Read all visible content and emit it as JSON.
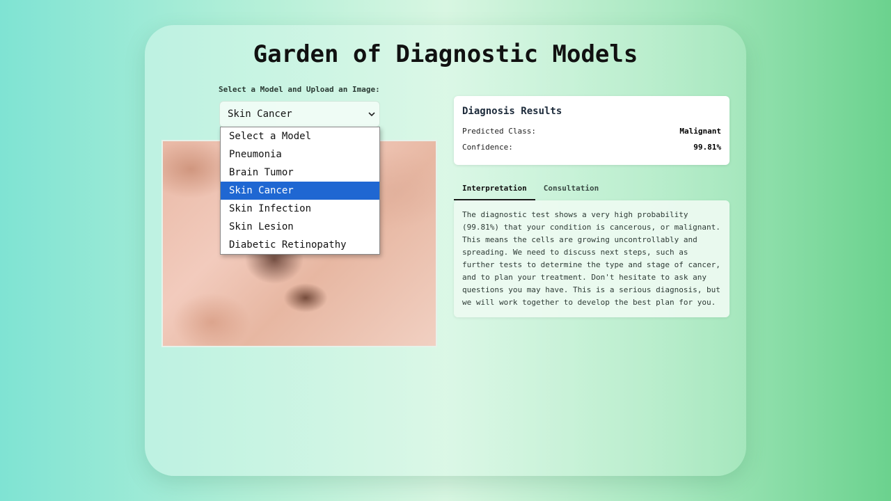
{
  "app": {
    "title": "Garden of Diagnostic Models"
  },
  "model_select": {
    "label": "Select a Model and Upload an Image:",
    "selected": "Skin Cancer",
    "options": [
      "Select a Model",
      "Pneumonia",
      "Brain Tumor",
      "Skin Cancer",
      "Skin Infection",
      "Skin Lesion",
      "Diabetic Retinopathy"
    ]
  },
  "results": {
    "title": "Diagnosis Results",
    "predicted_class_label": "Predicted Class:",
    "predicted_class_value": "Malignant",
    "confidence_label": "Confidence:",
    "confidence_value": "99.81%"
  },
  "tabs": [
    {
      "label": "Interpretation",
      "active": true
    },
    {
      "label": "Consultation",
      "active": false
    }
  ],
  "interpretation": {
    "text": "The diagnostic test shows a very high probability (99.81%) that your condition is cancerous, or malignant. This means the cells are growing uncontrollably and spreading. We need to discuss next steps, such as further tests to determine the type and stage of cancer, and to plan your treatment. Don't hesitate to ask any questions you may have. This is a serious diagnosis, but we will work together to develop the best plan for you."
  },
  "icons": {
    "select_chevron": "chevron-down-icon"
  },
  "colors": {
    "selected_option": "#1f67d2"
  }
}
